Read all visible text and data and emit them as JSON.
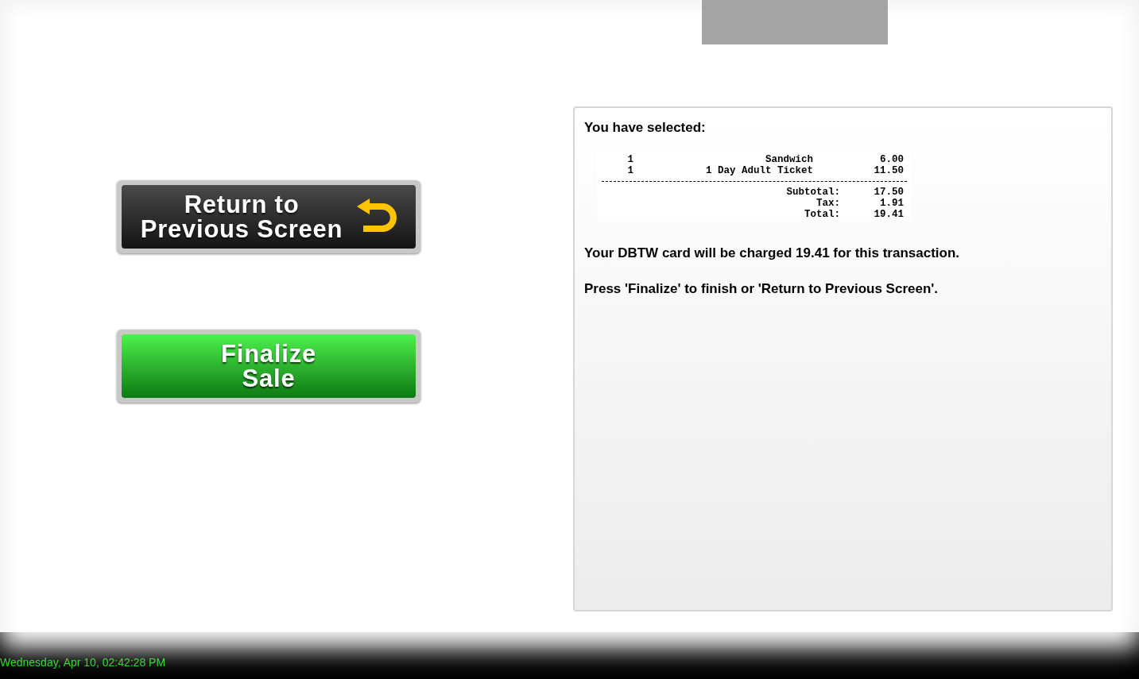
{
  "buttons": [
    {
      "kind": "back",
      "label_lines": [
        "Return to",
        "Previous Screen"
      ]
    },
    {
      "kind": "finalize",
      "label_lines": [
        "Finalize",
        "Sale"
      ]
    }
  ],
  "summary": {
    "heading": "You have selected:",
    "items": [
      {
        "qty": "1",
        "description": "Sandwich",
        "price": "6.00"
      },
      {
        "qty": "1",
        "description": "1 Day Adult Ticket",
        "price": "11.50"
      }
    ],
    "totals": [
      {
        "label": "Subtotal:",
        "value": "17.50"
      },
      {
        "label": "Tax:",
        "value": "1.91"
      },
      {
        "label": "Total:",
        "value": "19.41"
      }
    ],
    "messages": [
      "Your DBTW card will be charged 19.41 for this transaction.",
      "Press 'Finalize' to finish or 'Return to Previous Screen'."
    ]
  },
  "status_bar": {
    "datetime": "Wednesday, Apr 10, 02:42:28 PM"
  }
}
